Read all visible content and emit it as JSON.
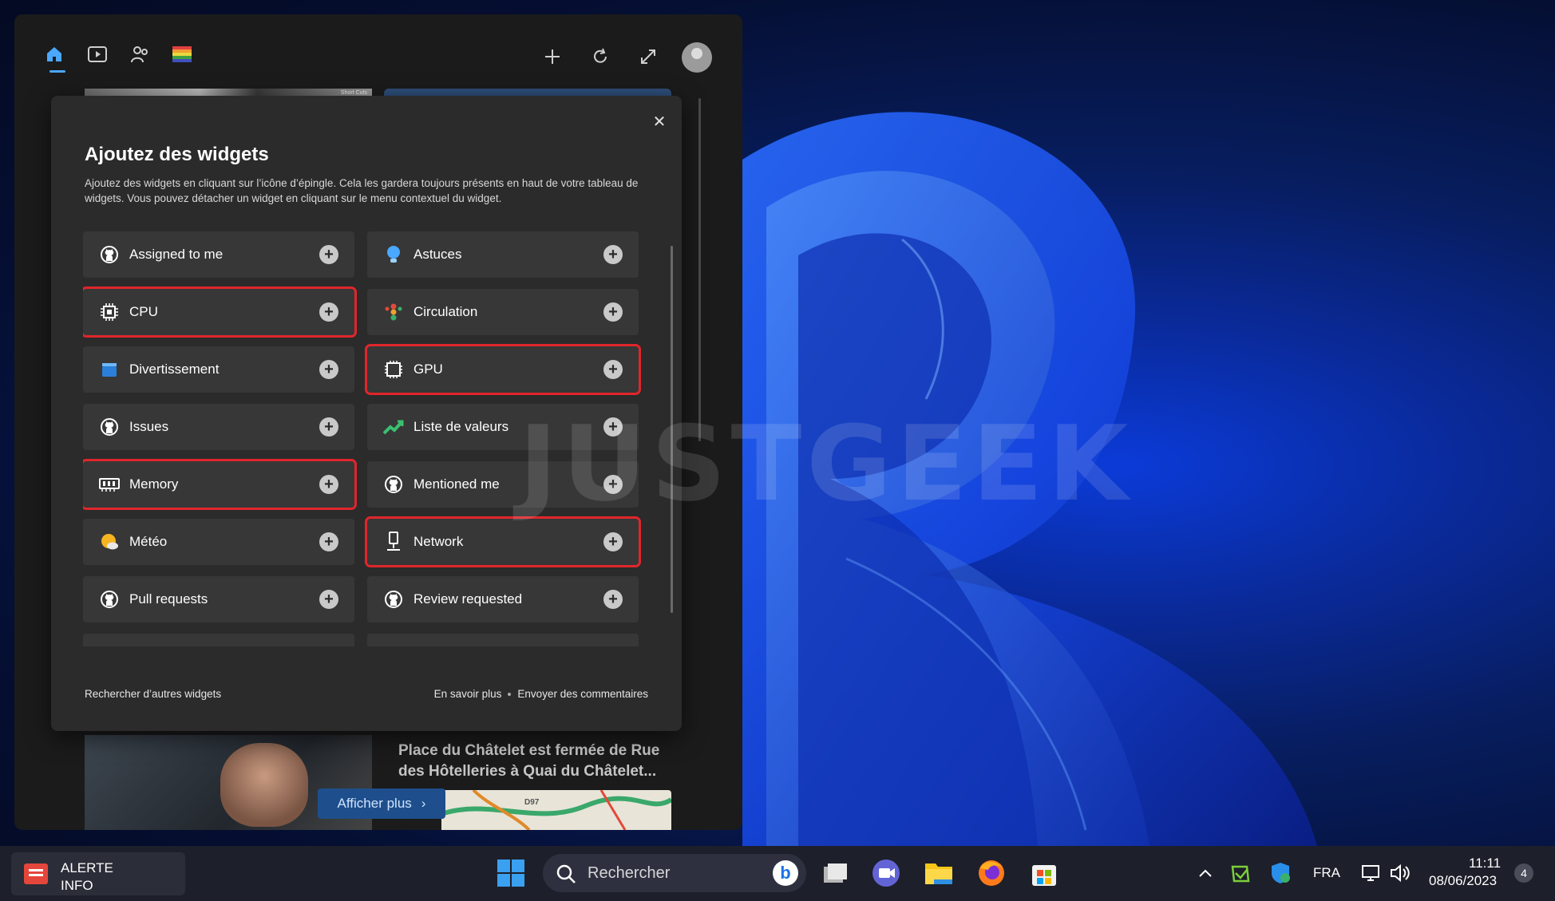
{
  "widgets_board": {
    "toolbar": {
      "home_icon": "home-icon",
      "video_icon": "video-icon",
      "people_icon": "people-icon",
      "flag_icon": "rainbow-flag-icon",
      "add_icon": "plus-icon",
      "refresh_icon": "refresh-icon",
      "expand_icon": "expand-icon",
      "avatar_icon": "avatar"
    },
    "news": {
      "headline": "Place du Châtelet est fermée de Rue des Hôtelleries à Quai du Châtelet...",
      "show_more_label": "Afficher plus",
      "map_label": "D97"
    },
    "peek_label": "Short Cuts"
  },
  "modal": {
    "title": "Ajoutez des widgets",
    "description": "Ajoutez des widgets en cliquant sur l’icône d’épingle. Cela les gardera toujours présents en haut de votre tableau de widgets. Vous pouvez détacher un widget en cliquant sur le menu contextuel du widget.",
    "close_icon": "close-icon",
    "widgets": [
      {
        "label": "Assigned to me",
        "icon": "github-icon",
        "highlighted": false
      },
      {
        "label": "Astuces",
        "icon": "lightbulb-icon",
        "highlighted": false
      },
      {
        "label": "CPU",
        "icon": "cpu-icon",
        "highlighted": true
      },
      {
        "label": "Circulation",
        "icon": "traffic-light-icon",
        "highlighted": false
      },
      {
        "label": "Divertissement",
        "icon": "clapperboard-icon",
        "highlighted": false
      },
      {
        "label": "GPU",
        "icon": "gpu-icon",
        "highlighted": true
      },
      {
        "label": "Issues",
        "icon": "github-icon",
        "highlighted": false
      },
      {
        "label": "Liste de valeurs",
        "icon": "stock-chart-icon",
        "highlighted": false
      },
      {
        "label": "Memory",
        "icon": "memory-icon",
        "highlighted": true
      },
      {
        "label": "Mentioned me",
        "icon": "github-icon",
        "highlighted": false
      },
      {
        "label": "Météo",
        "icon": "weather-sun-icon",
        "highlighted": false
      },
      {
        "label": "Network",
        "icon": "network-icon",
        "highlighted": true
      },
      {
        "label": "Pull requests",
        "icon": "github-icon",
        "highlighted": false
      },
      {
        "label": "Review requested",
        "icon": "github-icon",
        "highlighted": false
      }
    ],
    "footer": {
      "find_more": "Rechercher d’autres widgets",
      "learn_more": "En savoir plus",
      "send_feedback": "Envoyer des commentaires"
    },
    "highlight_color": "#e0262b"
  },
  "watermark": "JUSTGEEK",
  "taskbar": {
    "alert_title": "ALERTE",
    "alert_subtitle": "INFO",
    "search_placeholder": "Rechercher",
    "language": "FRA",
    "time": "11:11",
    "date": "08/06/2023",
    "notification_count": "4",
    "icons": [
      "start-icon",
      "search-icon",
      "bing-icon",
      "task-view-icon",
      "teams-icon",
      "file-explorer-icon",
      "firefox-icon",
      "store-icon",
      "chevron-up-icon",
      "app-tray-icon",
      "security-icon",
      "network-tray-icon",
      "volume-icon"
    ]
  },
  "colors": {
    "accent": "#4aa8ff",
    "modal_bg": "#2b2b2b",
    "item_bg": "#373737"
  }
}
